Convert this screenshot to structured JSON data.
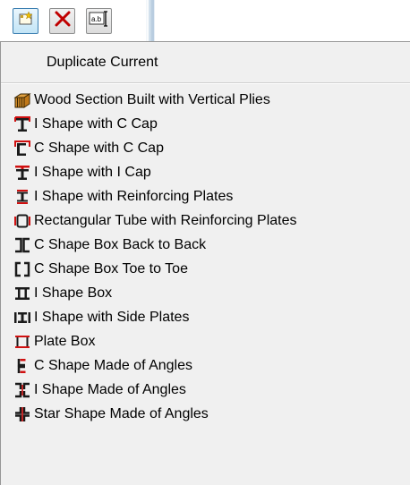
{
  "toolbar": {
    "buttons": [
      {
        "name": "new-section-button",
        "icon": "new-section-icon"
      },
      {
        "name": "delete-button",
        "icon": "delete-x-icon"
      },
      {
        "name": "rename-button",
        "icon": "rename-text-icon",
        "glyph": "a.b"
      }
    ]
  },
  "menu": {
    "duplicate_label": "Duplicate Current",
    "items": [
      {
        "label": "Wood Section Built with Vertical Plies",
        "icon": "wood-section-icon"
      },
      {
        "label": "I Shape with C Cap",
        "icon": "i-shape-c-cap-icon"
      },
      {
        "label": "C Shape with C Cap",
        "icon": "c-shape-c-cap-icon"
      },
      {
        "label": "I Shape with I Cap",
        "icon": "i-shape-i-cap-icon"
      },
      {
        "label": "I Shape with Reinforcing Plates",
        "icon": "i-shape-reinforcing-plates-icon"
      },
      {
        "label": "Rectangular Tube with Reinforcing Plates",
        "icon": "rectangular-tube-icon"
      },
      {
        "label": "C Shape Box Back to Back",
        "icon": "c-box-back-to-back-icon"
      },
      {
        "label": "C Shape Box Toe to Toe",
        "icon": "c-box-toe-to-toe-icon"
      },
      {
        "label": "I Shape Box",
        "icon": "i-shape-box-icon"
      },
      {
        "label": "I Shape with Side Plates",
        "icon": "i-shape-side-plates-icon"
      },
      {
        "label": "Plate Box",
        "icon": "plate-box-icon"
      },
      {
        "label": "C Shape Made of Angles",
        "icon": "c-shape-angles-icon"
      },
      {
        "label": "I Shape Made of Angles",
        "icon": "i-shape-angles-icon"
      },
      {
        "label": "Star Shape Made of Angles",
        "icon": "star-shape-angles-icon"
      }
    ]
  },
  "colors": {
    "icon_red": "#d01010",
    "icon_dark": "#1a1a1a",
    "menu_bg": "#f0f0f0",
    "button_border": "#3c7fb1"
  }
}
